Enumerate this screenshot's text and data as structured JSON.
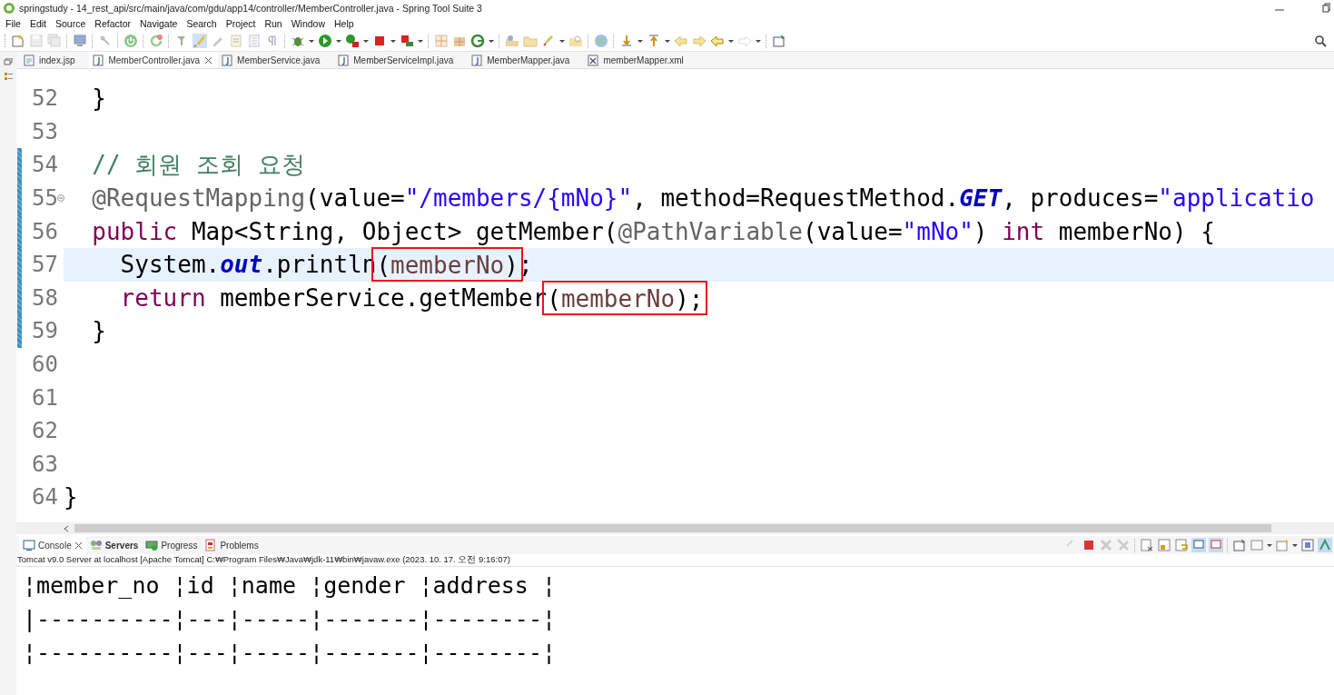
{
  "window": {
    "title": "springstudy - 14_rest_api/src/main/java/com/gdu/app14/controller/MemberController.java - Spring Tool Suite 3"
  },
  "menu": [
    "File",
    "Edit",
    "Source",
    "Refactor",
    "Navigate",
    "Search",
    "Project",
    "Run",
    "Window",
    "Help"
  ],
  "editor_tabs": [
    {
      "label": "index.jsp",
      "kind": "jsp",
      "selected": false
    },
    {
      "label": "MemberController.java",
      "kind": "java",
      "selected": true
    },
    {
      "label": "MemberService.java",
      "kind": "java",
      "selected": false
    },
    {
      "label": "MemberServiceImpl.java",
      "kind": "java",
      "selected": false
    },
    {
      "label": "MemberMapper.java",
      "kind": "java",
      "selected": false
    },
    {
      "label": "memberMapper.xml",
      "kind": "xml",
      "selected": false
    }
  ],
  "editor": {
    "lines": [
      {
        "number": "52",
        "segments": [
          {
            "kind": "plain",
            "text": "  }"
          }
        ]
      },
      {
        "number": "53"
      },
      {
        "number": "54",
        "changed": true,
        "segments": [
          {
            "kind": "comment",
            "text": "  // 회원 조회 요청"
          }
        ]
      },
      {
        "number": "55",
        "changed": true,
        "foldable": true,
        "segments": [
          {
            "kind": "annotation",
            "text": "  @RequestMapping"
          },
          {
            "kind": "plain",
            "text": "(value="
          },
          {
            "kind": "string",
            "text": "\"/members/{mNo}\""
          },
          {
            "kind": "plain",
            "text": ", method=RequestMethod."
          },
          {
            "kind": "static",
            "text": "GET"
          },
          {
            "kind": "plain",
            "text": ", produces="
          },
          {
            "kind": "string",
            "text": "\"applicatio"
          }
        ]
      },
      {
        "number": "56",
        "changed": true,
        "segments": [
          {
            "kind": "keyword",
            "text": "  public"
          },
          {
            "kind": "plain",
            "text": " Map<String, Object> getMember("
          },
          {
            "kind": "annotation",
            "text": "@PathVariable"
          },
          {
            "kind": "plain",
            "text": "(value="
          },
          {
            "kind": "string",
            "text": "\"mNo\""
          },
          {
            "kind": "plain",
            "text": ") "
          },
          {
            "kind": "keyword",
            "text": "int"
          },
          {
            "kind": "plain",
            "text": " memberNo) {"
          }
        ]
      },
      {
        "number": "57",
        "changed": true,
        "current": true,
        "segments": [
          {
            "kind": "plain",
            "text": "    System."
          },
          {
            "kind": "static",
            "text": "out"
          },
          {
            "kind": "plain",
            "text": ".println"
          },
          {
            "kind": "boxed",
            "children": [
              {
                "kind": "plain",
                "text": "("
              },
              {
                "kind": "variable",
                "text": "memberNo"
              },
              {
                "kind": "plain",
                "text": ")"
              }
            ]
          },
          {
            "kind": "plain",
            "text": ";"
          }
        ]
      },
      {
        "number": "58",
        "changed": true,
        "segments": [
          {
            "kind": "keyword",
            "text": "    return"
          },
          {
            "kind": "plain",
            "text": " memberService.getMember"
          },
          {
            "kind": "boxed",
            "children": [
              {
                "kind": "plain",
                "text": "("
              },
              {
                "kind": "variable",
                "text": "memberNo"
              },
              {
                "kind": "plain",
                "text": ");"
              }
            ]
          }
        ]
      },
      {
        "number": "59",
        "changed": true,
        "segments": [
          {
            "kind": "plain",
            "text": "  }"
          }
        ]
      },
      {
        "number": "60"
      },
      {
        "number": "61"
      },
      {
        "number": "62"
      },
      {
        "number": "63"
      },
      {
        "number": "64",
        "segments": [
          {
            "kind": "plain",
            "text": "}"
          }
        ]
      }
    ]
  },
  "console": {
    "tabs": [
      {
        "label": "Console",
        "selected": true,
        "updated": false
      },
      {
        "label": "Servers",
        "selected": false,
        "updated": true
      },
      {
        "label": "Progress",
        "selected": false,
        "updated": false
      },
      {
        "label": "Problems",
        "selected": false,
        "updated": false
      }
    ],
    "description": "Tomcat v9.0 Server at localhost [Apache Tomcat] C:₩Program Files₩Java₩jdk-11₩bin₩javaw.exe  (2023. 10. 17. 오전 9:16:07)",
    "output": [
      "¦member_no ¦id ¦name ¦gender ¦address ¦",
      "|----------¦---¦-----¦-------¦--------¦",
      "¦----------¦---¦-----¦-------¦--------¦"
    ]
  }
}
